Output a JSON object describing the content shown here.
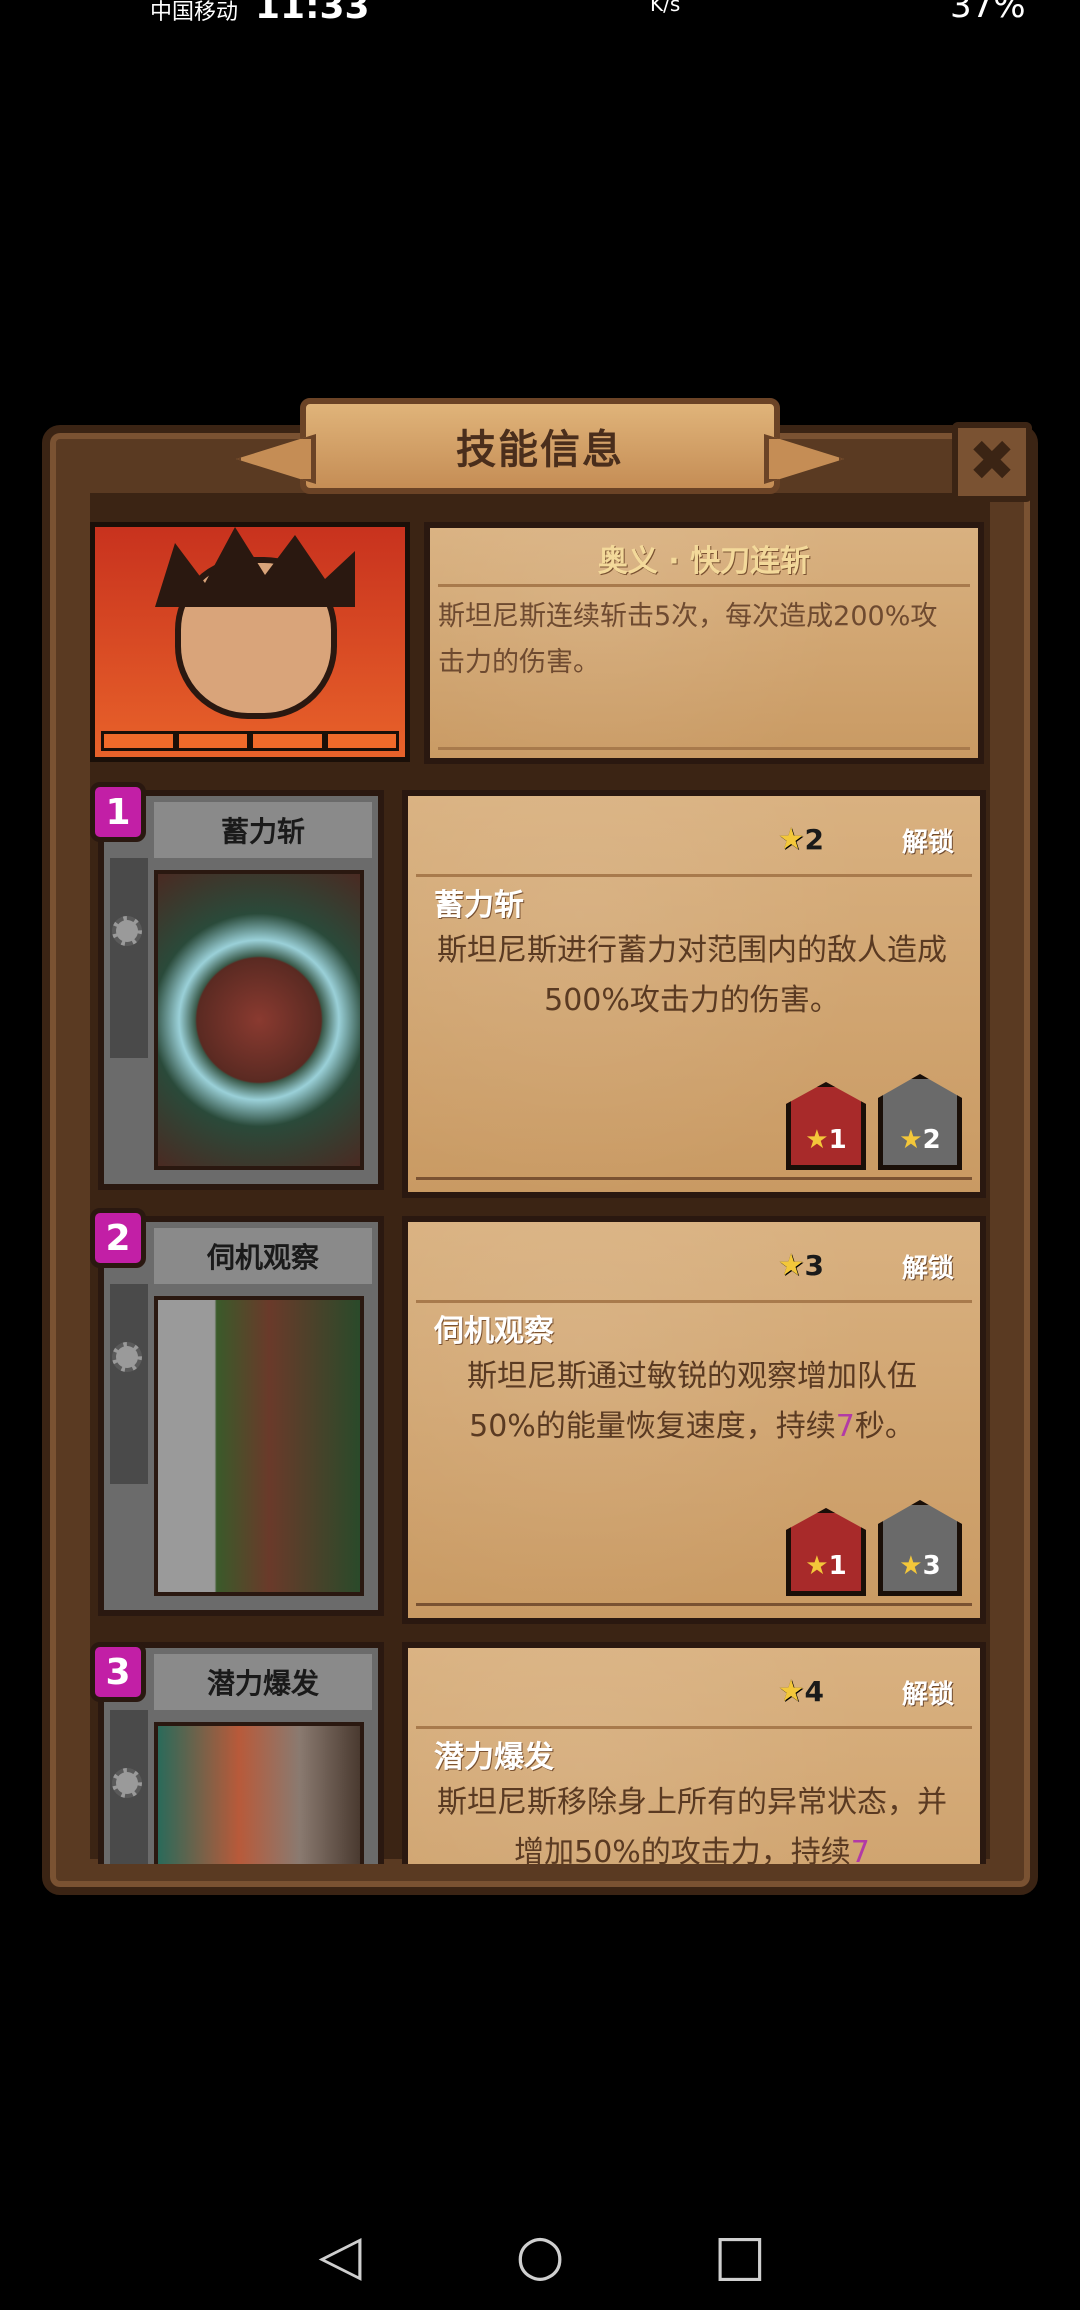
{
  "status_bar": {
    "carrier": "中国移动",
    "time": "11:33",
    "speed": "K/s",
    "battery": "37%"
  },
  "panel": {
    "title": "技能信息",
    "close_icon": "close-x-icon"
  },
  "ultimate": {
    "name": "奥义 · 快刀连斩",
    "description": "斯坦尼斯连续斩击5次，每次造成200%攻击力的伤害。"
  },
  "skills": [
    {
      "number": "1",
      "name": "蓄力斩",
      "star_req": "2",
      "unlock_label": "解锁",
      "title": "蓄力斩",
      "description": "斯坦尼斯进行蓄力对范围内的敌人造成500%攻击力的伤害。",
      "description_tail": "",
      "red_level": "1",
      "gray_level": "2"
    },
    {
      "number": "2",
      "name": "伺机观察",
      "star_req": "3",
      "unlock_label": "解锁",
      "title": "伺机观察",
      "description": "斯坦尼斯通过敏锐的观察增加队伍50%的能量恢复速度，持续",
      "highlight": "7",
      "description_tail": "秒。",
      "red_level": "1",
      "gray_level": "3"
    },
    {
      "number": "3",
      "name": "潜力爆发",
      "star_req": "4",
      "unlock_label": "解锁",
      "title": "潜力爆发",
      "description": "斯坦尼斯移除身上所有的异常状态，并增加50%的攻击力，持续",
      "highlight": "7",
      "description_tail": ""
    }
  ],
  "nav": {
    "back": "◁",
    "home": "○",
    "recent": "□"
  },
  "colors": {
    "panel_bg": "#5a3a22",
    "parchment": "#d9b180",
    "badge": "#c21fa6",
    "star": "#f3c73a"
  }
}
